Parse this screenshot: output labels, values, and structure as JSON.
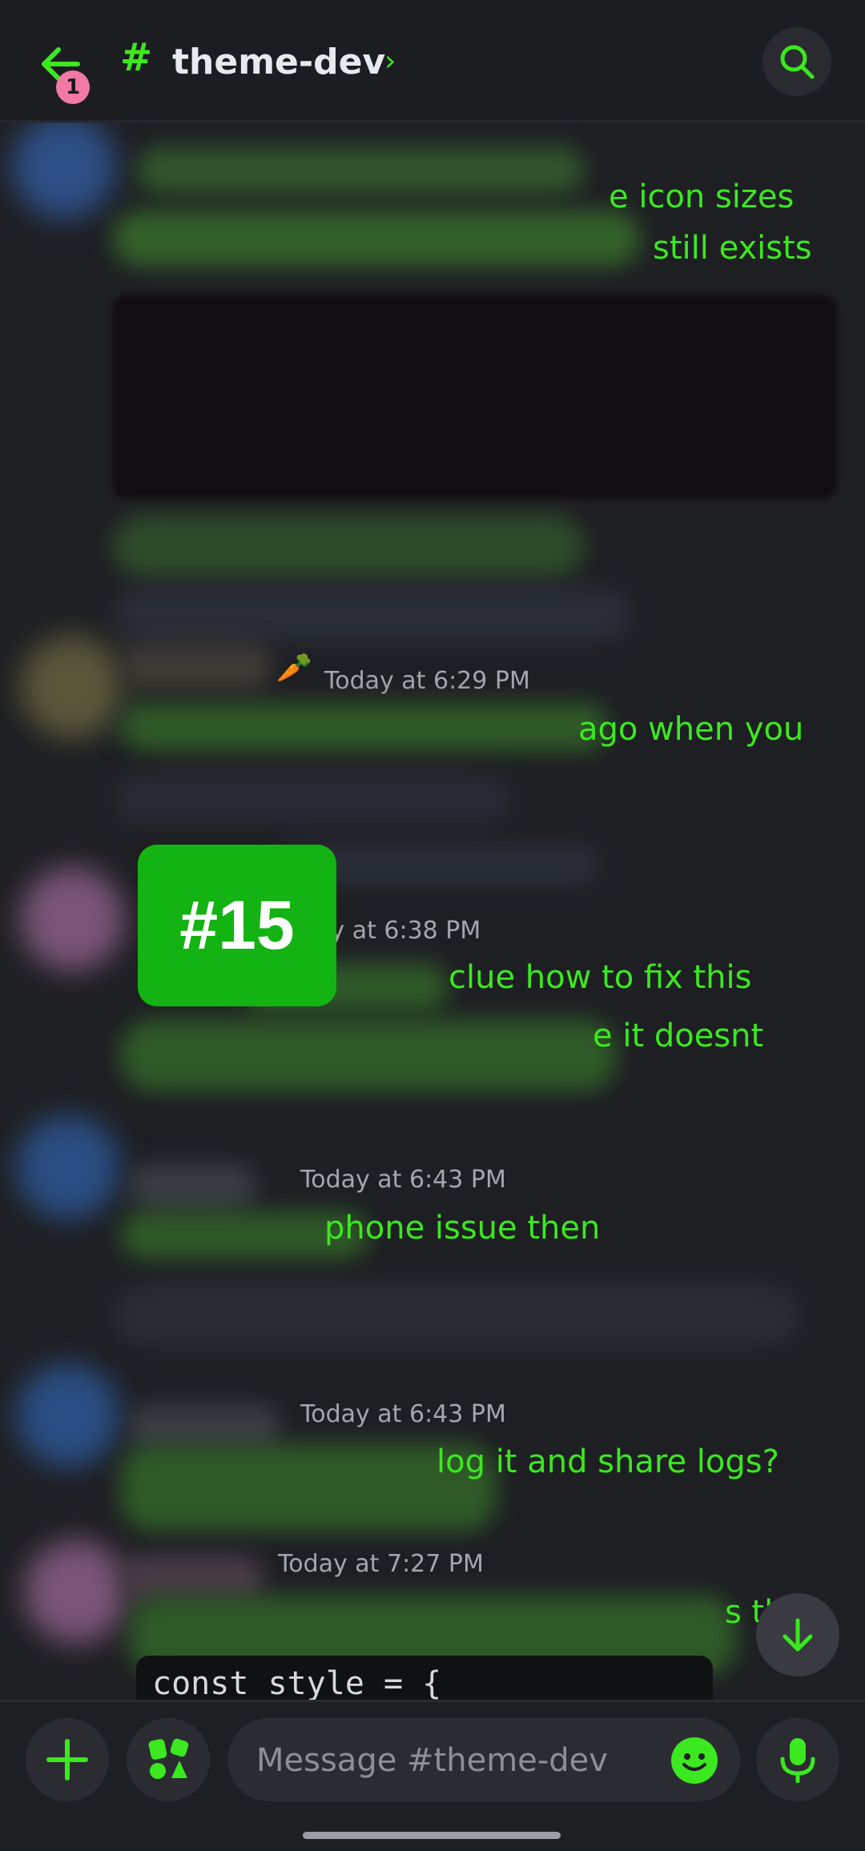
{
  "header": {
    "back_badge": "1",
    "hash": "#",
    "channel_name": "theme-dev",
    "chevron": "›"
  },
  "messages": [
    {
      "text_lines": [
        "e icon sizes",
        "still exists"
      ]
    },
    {
      "timestamp": "Today at 6:29 PM",
      "text_lines": [
        "ago when you"
      ]
    },
    {
      "timestamp": "day at 6:38 PM",
      "text_lines": [
        "clue how to fix this",
        "e it doesnt"
      ]
    },
    {
      "timestamp": "Today at 6:43 PM",
      "text_lines": [
        "phone issue then"
      ]
    },
    {
      "timestamp": "Today at 6:43 PM",
      "text_lines": [
        "log it and share logs?"
      ]
    },
    {
      "timestamp": "Today at 7:27 PM",
      "text_lines": [
        "s th"
      ]
    }
  ],
  "code_snippet": "const style = {",
  "overlay_label": "#15",
  "composer": {
    "placeholder": "Message #theme-dev"
  },
  "icons": {
    "back": "arrow-left-icon",
    "search": "search-icon",
    "add": "plus-icon",
    "apps": "apps-icon",
    "emoji": "emoji-icon",
    "mic": "microphone-icon",
    "jump": "arrow-down-icon"
  },
  "colors": {
    "accent": "#3ce81f",
    "badge": "#f17aa4",
    "label_bg": "#12b312"
  }
}
